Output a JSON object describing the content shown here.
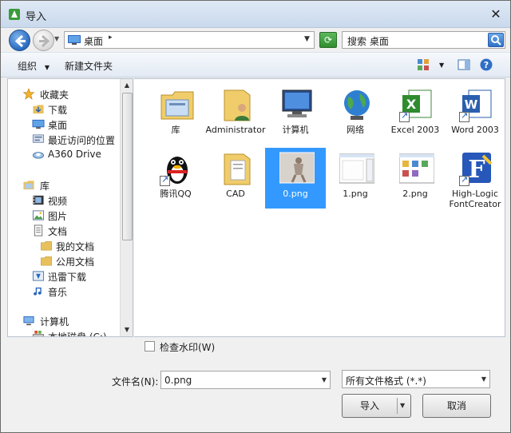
{
  "window": {
    "title": "导入",
    "close_glyph": "✕"
  },
  "nav": {
    "address": "桌面",
    "search_placeholder": "搜索 桌面"
  },
  "toolbar": {
    "organize": "组织",
    "new_folder": "新建文件夹"
  },
  "sidebar": {
    "items": [
      {
        "label": "收藏夹",
        "icon": "star-icon",
        "indent": 0
      },
      {
        "label": "下载",
        "icon": "downloads-folder-icon",
        "indent": 1
      },
      {
        "label": "桌面",
        "icon": "desktop-icon",
        "indent": 1
      },
      {
        "label": "最近访问的位置",
        "icon": "recent-places-icon",
        "indent": 1
      },
      {
        "label": "A360 Drive",
        "icon": "cloud-drive-icon",
        "indent": 1
      },
      {
        "label": "库",
        "icon": "library-icon",
        "indent": 0
      },
      {
        "label": "视频",
        "icon": "video-library-icon",
        "indent": 1
      },
      {
        "label": "图片",
        "icon": "pictures-library-icon",
        "indent": 1
      },
      {
        "label": "文档",
        "icon": "documents-library-icon",
        "indent": 1
      },
      {
        "label": "我的文档",
        "icon": "folder-icon",
        "indent": 2
      },
      {
        "label": "公用文档",
        "icon": "folder-icon",
        "indent": 2
      },
      {
        "label": "迅雷下载",
        "icon": "thunder-download-icon",
        "indent": 1
      },
      {
        "label": "音乐",
        "icon": "music-library-icon",
        "indent": 1
      },
      {
        "label": "计算机",
        "icon": "computer-icon",
        "indent": 0
      },
      {
        "label": "本地磁盘 (C:)",
        "icon": "local-disk-icon",
        "indent": 1
      }
    ]
  },
  "files": [
    {
      "label": "库",
      "icon": "library-folder-icon"
    },
    {
      "label": "Administrator",
      "icon": "user-folder-icon"
    },
    {
      "label": "计算机",
      "icon": "computer-icon"
    },
    {
      "label": "网络",
      "icon": "network-globe-icon"
    },
    {
      "label": "Excel 2003",
      "icon": "excel-icon"
    },
    {
      "label": "Word 2003",
      "icon": "word-icon"
    },
    {
      "label": "腾讯QQ",
      "icon": "qq-penguin-icon"
    },
    {
      "label": "CAD",
      "icon": "cad-folder-icon"
    },
    {
      "label": "0.png",
      "icon": "image-thumbnail-icon",
      "selected": true
    },
    {
      "label": "1.png",
      "icon": "image-thumbnail-icon"
    },
    {
      "label": "2.png",
      "icon": "image-thumbnail-icon"
    },
    {
      "label": "High-Logic FontCreator",
      "icon": "fontcreator-icon"
    }
  ],
  "options": {
    "watermark_label": "检查水印(W)"
  },
  "footer": {
    "filename_label": "文件名(N):",
    "filename_value": "0.png",
    "filetype_value": "所有文件格式 (*.*)",
    "import_label": "导入",
    "cancel_label": "取消"
  }
}
